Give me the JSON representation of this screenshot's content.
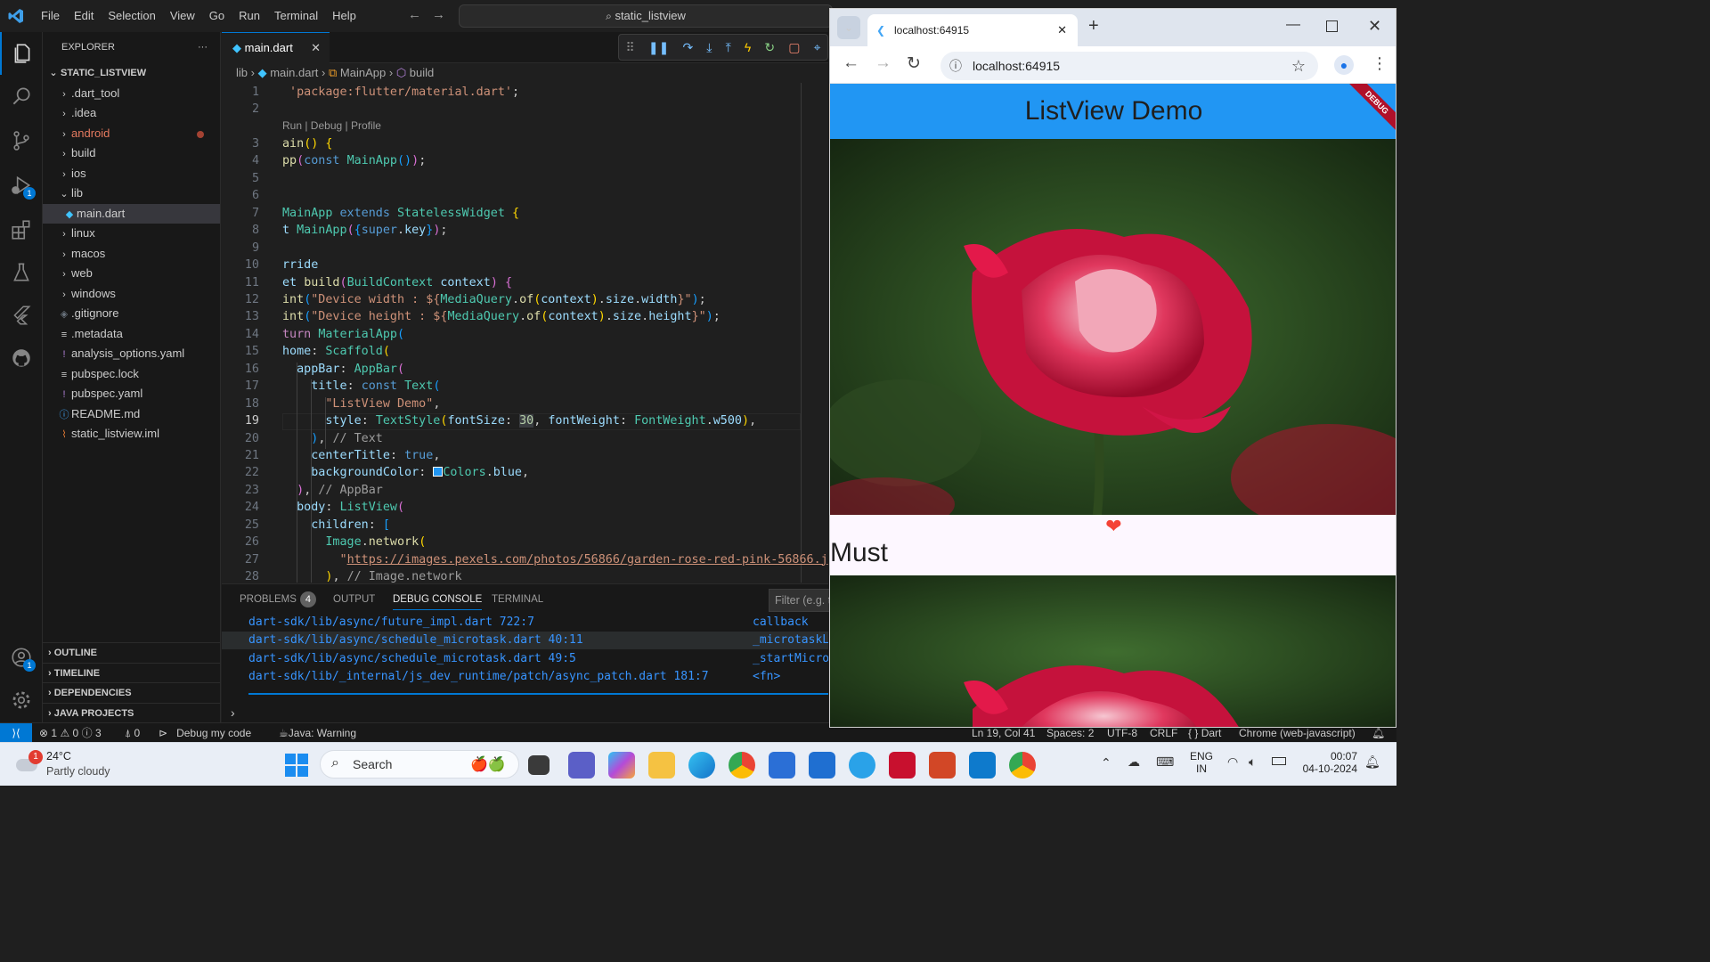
{
  "titlebar": {
    "menu": [
      "File",
      "Edit",
      "Selection",
      "View",
      "Go",
      "Run",
      "Terminal",
      "Help"
    ],
    "search": "static_listview"
  },
  "sidebar": {
    "title": "EXPLORER",
    "more": "···",
    "project": "STATIC_LISTVIEW",
    "items": [
      {
        "label": ".dart_tool",
        "type": "folder",
        "open": false,
        "color": "#cccccc"
      },
      {
        "label": ".idea",
        "type": "folder",
        "open": false,
        "color": "#cccccc"
      },
      {
        "label": "android",
        "type": "folder",
        "open": false,
        "color": "#e57a5f"
      },
      {
        "label": "build",
        "type": "folder",
        "open": false,
        "color": "#cccccc"
      },
      {
        "label": "ios",
        "type": "folder",
        "open": false,
        "color": "#cccccc"
      },
      {
        "label": "lib",
        "type": "folder",
        "open": true,
        "color": "#cccccc"
      },
      {
        "label": "main.dart",
        "type": "file",
        "color": "#cccccc"
      },
      {
        "label": "linux",
        "type": "folder",
        "open": false,
        "color": "#cccccc"
      },
      {
        "label": "macos",
        "type": "folder",
        "open": false,
        "color": "#cccccc"
      },
      {
        "label": "web",
        "type": "folder",
        "open": false,
        "color": "#cccccc"
      },
      {
        "label": "windows",
        "type": "folder",
        "open": false,
        "color": "#cccccc"
      },
      {
        "label": ".gitignore",
        "type": "file",
        "color": "#cccccc"
      },
      {
        "label": ".metadata",
        "type": "file",
        "color": "#cccccc"
      },
      {
        "label": "analysis_options.yaml",
        "type": "file",
        "color": "#cccccc"
      },
      {
        "label": "pubspec.lock",
        "type": "file",
        "color": "#cccccc"
      },
      {
        "label": "pubspec.yaml",
        "type": "file",
        "color": "#cccccc"
      },
      {
        "label": "README.md",
        "type": "file",
        "color": "#cccccc"
      },
      {
        "label": "static_listview.iml",
        "type": "file",
        "color": "#cccccc"
      }
    ],
    "sections": [
      "OUTLINE",
      "TIMELINE",
      "DEPENDENCIES",
      "JAVA PROJECTS"
    ]
  },
  "editor": {
    "tab": "main.dart",
    "breadcrumb": [
      "lib",
      "main.dart",
      "MainApp",
      "build"
    ],
    "codelens": "Run | Debug | Profile",
    "line_numbers": [
      "1",
      "2",
      "3",
      "4",
      "5",
      "6",
      "7",
      "8",
      "9",
      "10",
      "11",
      "12",
      "13",
      "14",
      "15",
      "16",
      "17",
      "18",
      "19",
      "20",
      "21",
      "22",
      "23",
      "24",
      "25",
      "26",
      "27",
      "28"
    ]
  },
  "panel": {
    "tabs": [
      "PROBLEMS",
      "OUTPUT",
      "DEBUG CONSOLE",
      "TERMINAL"
    ],
    "problems_count": "4",
    "filter_placeholder": "Filter (e.g. t",
    "rows": [
      {
        "path": "dart-sdk/lib/async/future_impl.dart 722:7",
        "fn": "callback"
      },
      {
        "path": "dart-sdk/lib/async/schedule_microtask.dart 40:11",
        "fn": "_microtaskL"
      },
      {
        "path": "dart-sdk/lib/async/schedule_microtask.dart 49:5",
        "fn": "_startMicro"
      },
      {
        "path": "dart-sdk/lib/_internal/js_dev_runtime/patch/async_patch.dart 181:7",
        "fn": "<fn>"
      }
    ]
  },
  "statusbar": {
    "errors": "1",
    "warnings": "0",
    "infos": "3",
    "ports": "0",
    "debug": "Debug my code",
    "java": "Java: Warning",
    "position": "Ln 19, Col 41",
    "spaces": "Spaces: 2",
    "encoding": "UTF-8",
    "eol": "CRLF",
    "language": "Dart",
    "device": "Chrome (web-javascript)"
  },
  "browser": {
    "tab_title": "localhost:64915",
    "url": "localhost:64915",
    "app_title": "ListView Demo",
    "debug_banner": "DEBUG",
    "heart": "❤",
    "list_text": "Must"
  },
  "taskbar": {
    "weather_temp": "24°C",
    "weather_desc": "Partly cloudy",
    "weather_badge": "1",
    "search": "Search",
    "lang_top": "ENG",
    "lang_bottom": "IN",
    "time": "00:07",
    "date": "04-10-2024"
  }
}
